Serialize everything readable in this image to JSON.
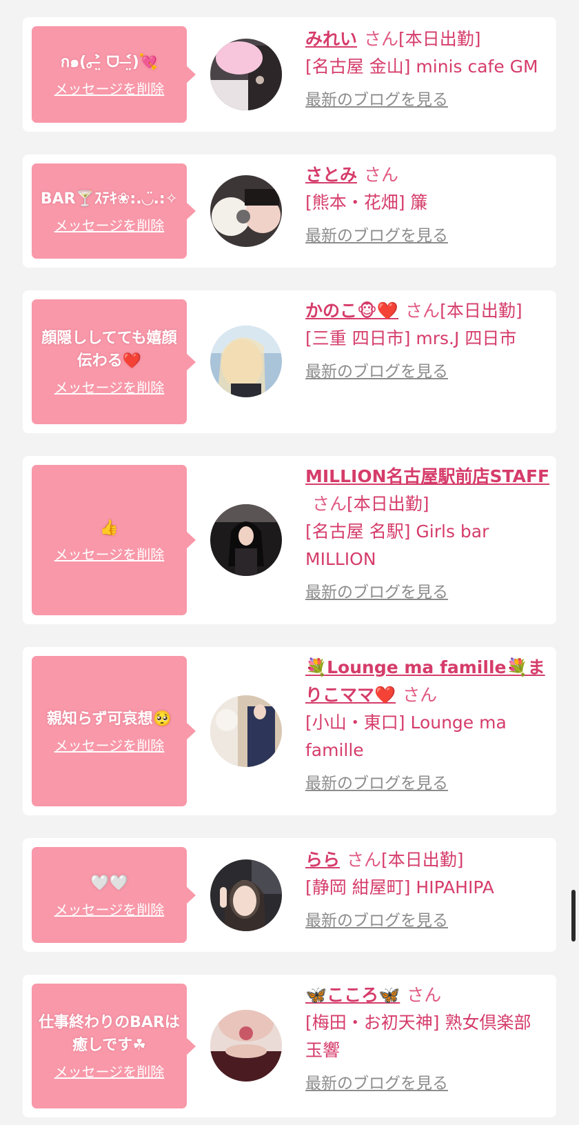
{
  "common": {
    "delete_label": "メッセージを削除",
    "blog_label": "最新のブログを見る",
    "san_suffix": "さん"
  },
  "entries": [
    {
      "message": "ก๑(｡˃̶̤̀ ᗜ ˂̶̤́)💘",
      "name": "みれい",
      "status": "[本日出勤]",
      "shop": "[名古屋 金山] minis cafe GM"
    },
    {
      "message": "BAR🍸ｽﾃｷ❀:.◡̈.:✧",
      "name": "さとみ",
      "status": "",
      "shop": "[熊本・花畑] 簾"
    },
    {
      "message": "顔隠ししてても嬉顔伝わる❤️",
      "name": "かのこ🐵❤️",
      "status": "[本日出勤]",
      "shop": "[三重 四日市] mrs.J 四日市"
    },
    {
      "message": "👍",
      "name": "MILLION名古屋駅前店STAFF",
      "status": "[本日出勤]",
      "shop": "[名古屋 名駅] Girls bar MILLION"
    },
    {
      "message": "親知らず可哀想🥺",
      "name": "💐Lounge ma famille💐まりこママ❤️",
      "status": "",
      "shop": "[小山・東口] Lounge ma famille"
    },
    {
      "message": "🤍🤍",
      "name": "らら",
      "status": "[本日出勤]",
      "shop": "[静岡 紺屋町] HIPAHIPA"
    },
    {
      "message": "仕事終わりのBARは癒しです☘",
      "name": "🦋こころ🦋",
      "status": "",
      "shop": "[梅田・お初天神] 熟女倶楽部 玉響"
    }
  ]
}
